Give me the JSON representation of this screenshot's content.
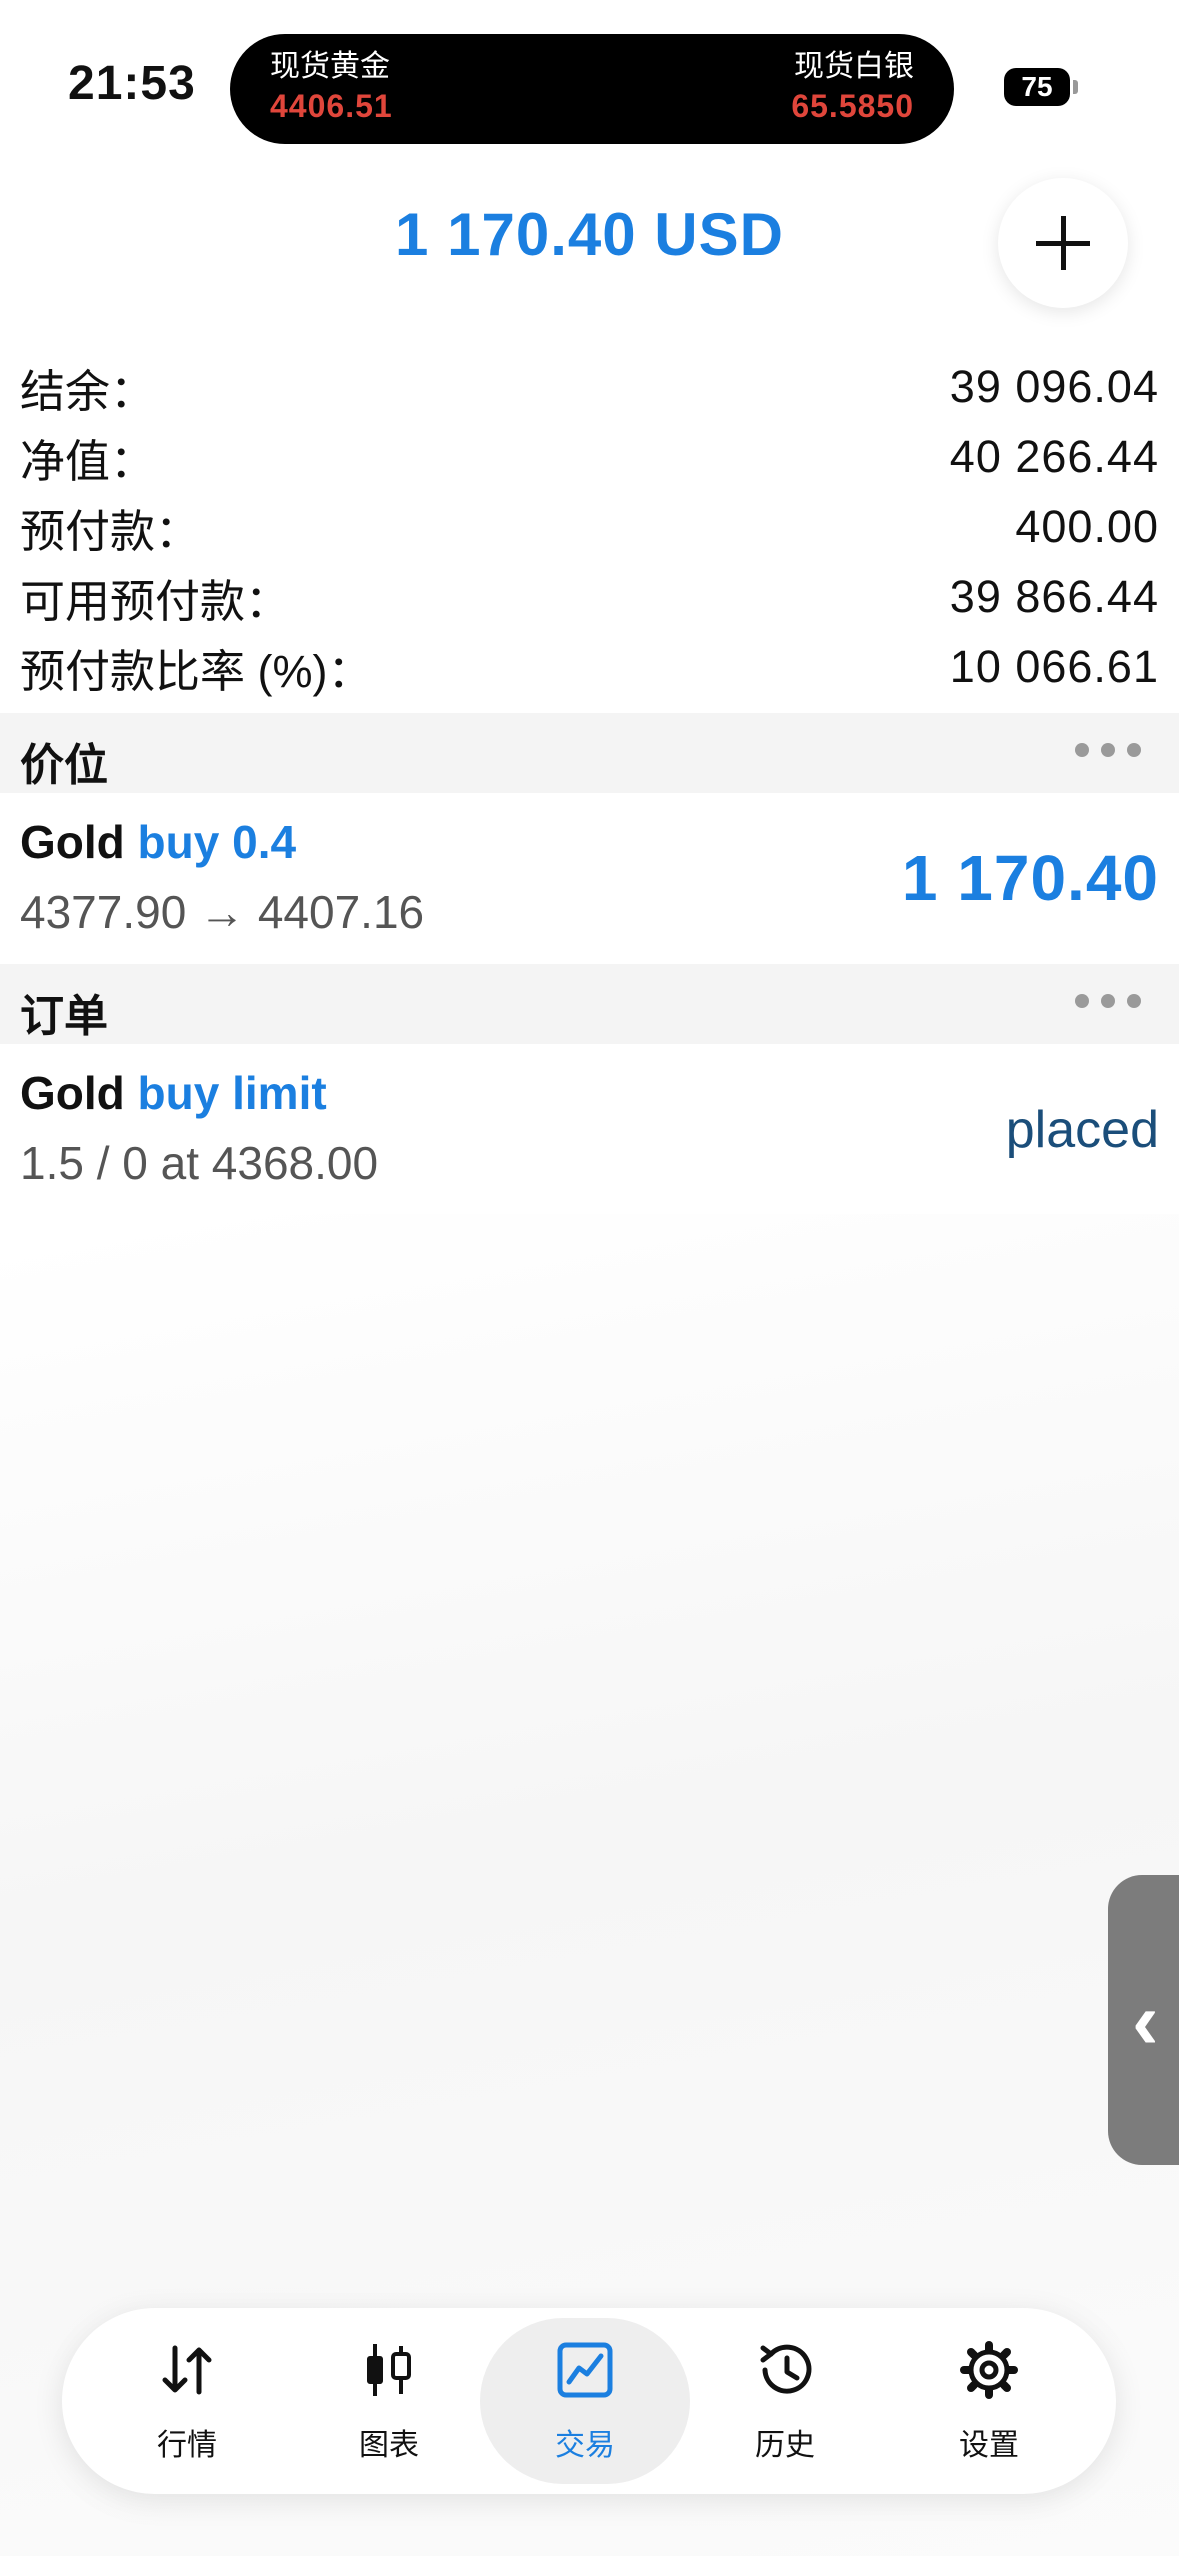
{
  "status": {
    "time": "21:53",
    "battery": "75"
  },
  "island": {
    "left": {
      "name": "现货黄金",
      "price": "4406.51"
    },
    "right": {
      "name": "现货白银",
      "price": "65.5850"
    }
  },
  "header": {
    "total": "1 170.40 USD"
  },
  "summary": [
    {
      "label": "结余：",
      "value": "39 096.04"
    },
    {
      "label": "净值：",
      "value": "40 266.44"
    },
    {
      "label": "预付款：",
      "value": "400.00"
    },
    {
      "label": "可用预付款：",
      "value": "39 866.44"
    },
    {
      "label": "预付款比率 (%)：",
      "value": "10 066.61"
    }
  ],
  "positions": {
    "title": "价位",
    "items": [
      {
        "symbol": "Gold",
        "direction": "buy 0.4",
        "detail": "4377.90 → 4407.16",
        "profit": "1 170.40"
      }
    ]
  },
  "orders": {
    "title": "订单",
    "items": [
      {
        "symbol": "Gold",
        "direction": "buy limit",
        "detail": "1.5 / 0 at 4368.00",
        "state": "placed"
      }
    ]
  },
  "tabs": [
    {
      "label": "行情",
      "icon": "quotes-arrows-icon",
      "active": false
    },
    {
      "label": "图表",
      "icon": "chart-candles-icon",
      "active": false
    },
    {
      "label": "交易",
      "icon": "trade-chart-icon",
      "active": true
    },
    {
      "label": "历史",
      "icon": "history-clock-icon",
      "active": false
    },
    {
      "label": "设置",
      "icon": "settings-gear-icon",
      "active": false
    }
  ],
  "colors": {
    "accent": "#1b7fe0",
    "island_price": "#e0463b",
    "placed": "#1b4e7a"
  }
}
